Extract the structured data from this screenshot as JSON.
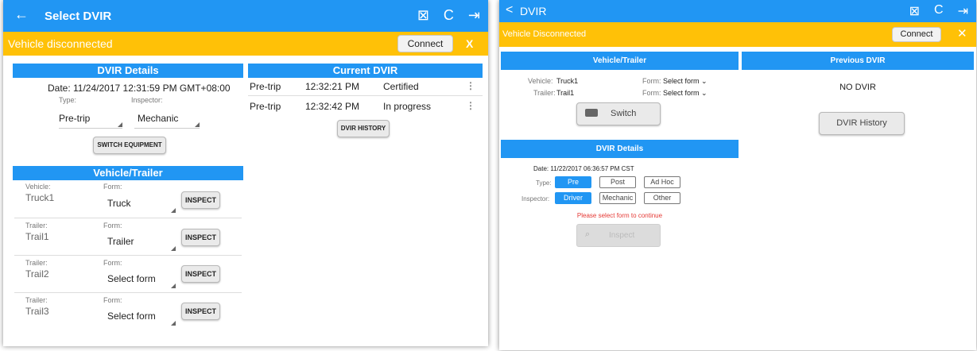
{
  "left": {
    "appbar": {
      "title": "Select DVIR",
      "back_icon": "←",
      "icons": [
        "⊠",
        "C",
        "⇥"
      ]
    },
    "status": {
      "message": "Vehicle disconnected",
      "connect_label": "Connect",
      "close_label": "X"
    },
    "dvir_details": {
      "header": "DVIR Details",
      "date": "Date: 11/24/2017 12:31:59 PM GMT+08:00",
      "type_label": "Type:",
      "type_value": "Pre-trip",
      "inspector_label": "Inspector:",
      "inspector_value": "Mechanic",
      "switch_button": "SWITCH EQUIPMENT"
    },
    "vehicle_trailer": {
      "header": "Vehicle/Trailer",
      "rows": [
        {
          "label": "Vehicle:",
          "name": "Truck1",
          "form_label": "Form:",
          "form": "Truck",
          "button": "INSPECT"
        },
        {
          "label": "Trailer:",
          "name": "Trail1",
          "form_label": "Form:",
          "form": "Trailer",
          "button": "INSPECT"
        },
        {
          "label": "Trailer:",
          "name": "Trail2",
          "form_label": "Form:",
          "form": "Select form",
          "button": "INSPECT"
        },
        {
          "label": "Trailer:",
          "name": "Trail3",
          "form_label": "Form:",
          "form": "Select form",
          "button": "INSPECT"
        }
      ]
    },
    "current_dvir": {
      "header": "Current DVIR",
      "rows": [
        {
          "type": "Pre-trip",
          "time": "12:32:21 PM",
          "status": "Certified",
          "menu": "⋮"
        },
        {
          "type": "Pre-trip",
          "time": "12:32:42 PM",
          "status": "In progress",
          "menu": "⋮"
        }
      ],
      "history_button": "DVIR HISTORY"
    }
  },
  "right": {
    "appbar": {
      "title": "DVIR",
      "back_icon": "<",
      "icons": [
        "⊠",
        "C",
        "⇥"
      ]
    },
    "status": {
      "message": "Vehicle Disconnected",
      "connect_label": "Connect",
      "close_label": "✕"
    },
    "vehicle_trailer": {
      "header": "Vehicle/Trailer",
      "vehicle_label": "Vehicle:",
      "vehicle_value": "Truck1",
      "trailer_label": "Trailer:",
      "trailer_value": "Trail1",
      "form_label": "Form:",
      "form_select": "Select form ⌄",
      "switch_button": "Switch"
    },
    "previous_dvir": {
      "header": "Previous DVIR",
      "empty_text": "NO DVIR",
      "history_button": "DVIR History"
    },
    "dvir_details": {
      "header": "DVIR Details",
      "date": "Date: 11/22/2017 06:36:57 PM CST",
      "type_label": "Type:",
      "type_options": [
        "Pre",
        "Post",
        "Ad Hoc"
      ],
      "inspector_label": "Inspector:",
      "inspector_options": [
        "Driver",
        "Mechanic",
        "Other"
      ],
      "warning": "Please select form to continue",
      "inspect_button": "Inspect"
    }
  },
  "colors": {
    "header_blue": "#2196f3",
    "warning_yellow": "#ffc107",
    "error_red": "#e53935"
  }
}
